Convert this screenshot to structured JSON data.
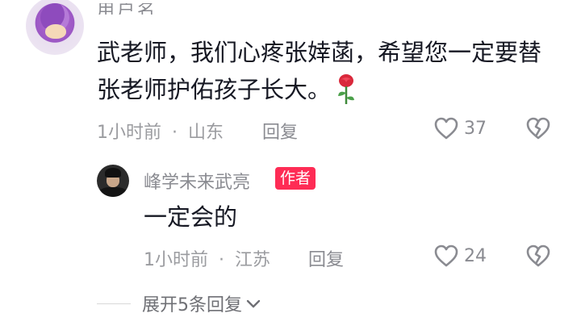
{
  "comment": {
    "user_name": "用户名",
    "text": "武老师，我们心疼张婞菡，希望您一定要替张老师护佑孩子长大。",
    "emoji": "rose-icon",
    "time": "1小时前",
    "separator": "·",
    "location": "山东",
    "reply_label": "回复",
    "like_count": "37"
  },
  "reply": {
    "user_name": "峰学未来武亮",
    "badge": "作者",
    "text": "一定会的",
    "time": "1小时前",
    "separator": "·",
    "location": "江苏",
    "reply_label": "回复",
    "like_count": "24"
  },
  "expand": {
    "label": "展开5条回复"
  },
  "colors": {
    "text_primary": "#161823",
    "text_secondary": "#8a8b91",
    "badge_bg": "#fe2c55"
  }
}
